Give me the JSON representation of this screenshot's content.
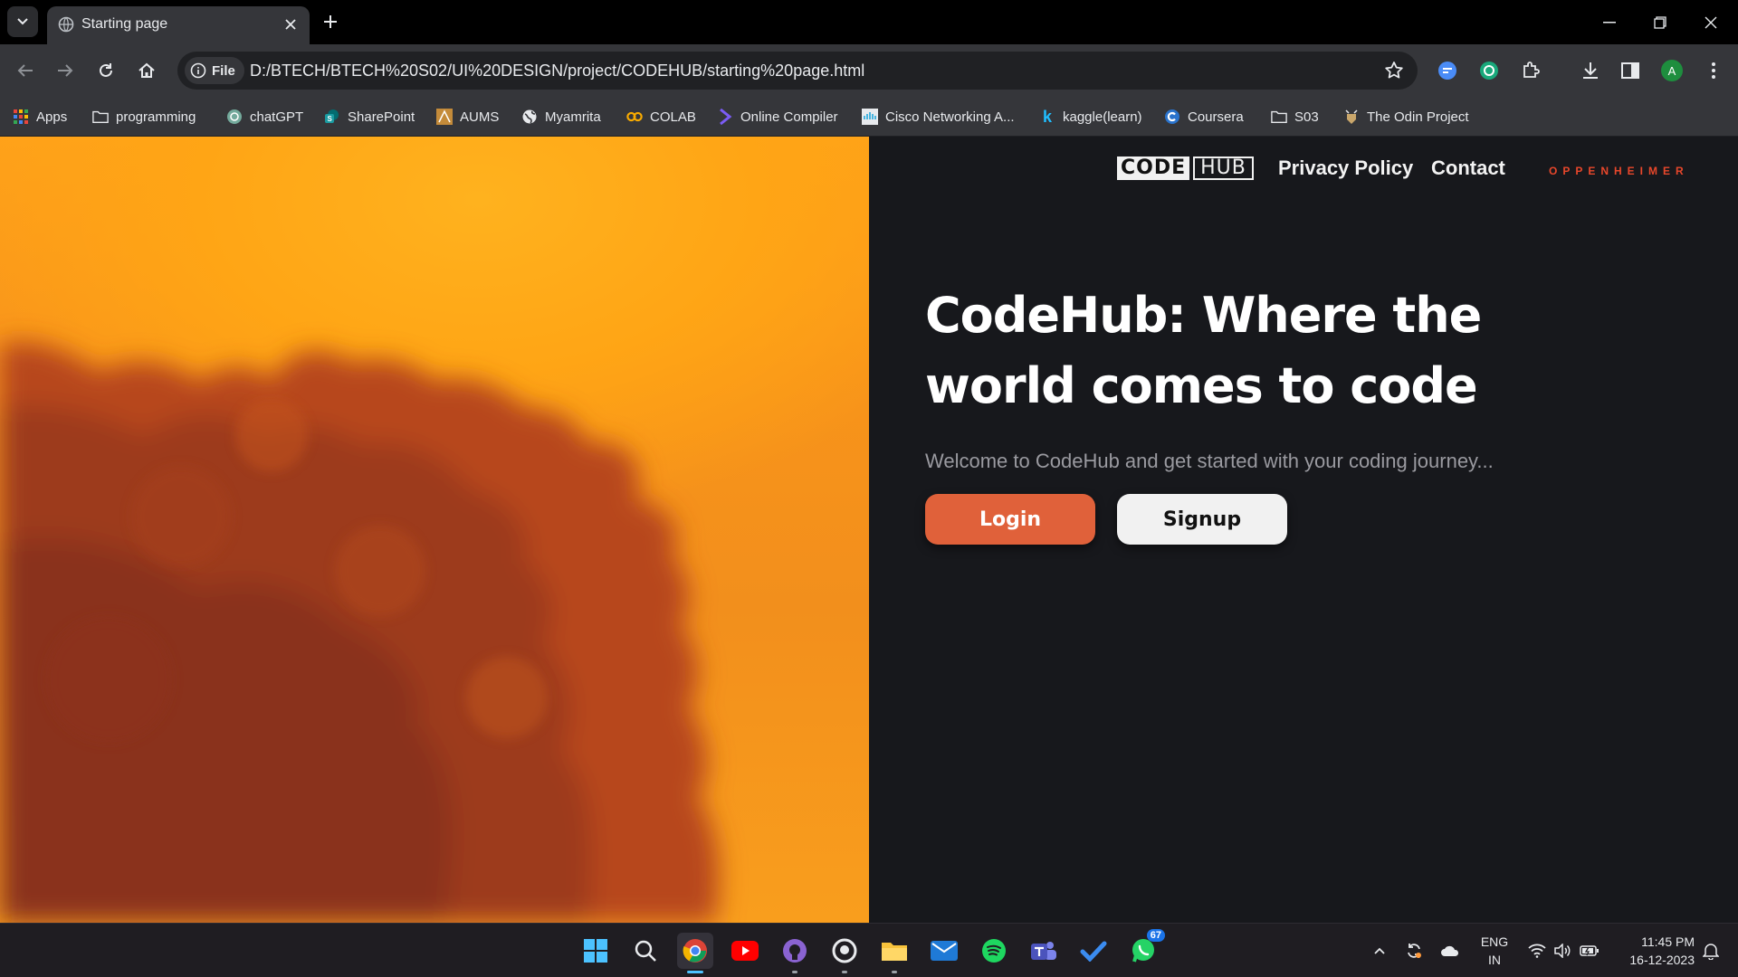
{
  "browser": {
    "tab_title": "Starting page",
    "url_chip": "File",
    "url": "D:/BTECH/BTECH%20S02/UI%20DESIGN/project/CODEHUB/starting%20page.html",
    "profile_initial": "A"
  },
  "bookmarks": [
    {
      "label": "Apps",
      "icon": "apps-grid-icon"
    },
    {
      "label": "programming",
      "icon": "folder-icon"
    },
    {
      "label": "chatGPT",
      "icon": "chatgpt-icon"
    },
    {
      "label": "SharePoint",
      "icon": "sharepoint-icon"
    },
    {
      "label": "AUMS",
      "icon": "aums-icon"
    },
    {
      "label": "Myamrita",
      "icon": "globe-icon"
    },
    {
      "label": "COLAB",
      "icon": "colab-icon"
    },
    {
      "label": "Online Compiler",
      "icon": "compiler-icon"
    },
    {
      "label": "Cisco Networking A...",
      "icon": "cisco-icon"
    },
    {
      "label": "kaggle(learn)",
      "icon": "kaggle-icon"
    },
    {
      "label": "Coursera",
      "icon": "coursera-icon"
    },
    {
      "label": "S03",
      "icon": "folder-icon"
    },
    {
      "label": "The Odin Project",
      "icon": "odin-icon"
    }
  ],
  "site": {
    "logo_left": "CODE",
    "logo_right": "HUB",
    "nav_privacy": "Privacy Policy",
    "nav_contact": "Contact",
    "brand": "OPPENHEIMER",
    "headline": "CodeHub: Where the world comes to code",
    "subline": "Welcome to CodeHub and get started with your coding journey...",
    "login_label": "Login",
    "signup_label": "Signup"
  },
  "taskbar": {
    "whatsapp_badge": "67",
    "lang_top": "ENG",
    "lang_bottom": "IN",
    "time": "11:45 PM",
    "date": "16-12-2023"
  },
  "colors": {
    "accent_orange": "#e0613a",
    "brand_red": "#e8472b",
    "page_bg": "#17181c"
  }
}
